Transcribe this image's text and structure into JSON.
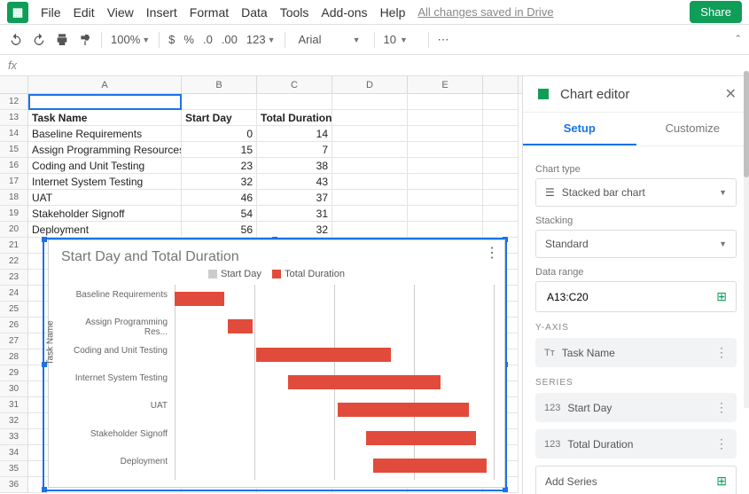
{
  "menu": {
    "items": [
      "File",
      "Edit",
      "View",
      "Insert",
      "Format",
      "Data",
      "Tools",
      "Add-ons",
      "Help"
    ],
    "save_status": "All changes saved in Drive",
    "share": "Share"
  },
  "toolbar": {
    "zoom": "100%",
    "currency": "$",
    "percent": "%",
    "dec_dec": ".0",
    "inc_dec": ".00",
    "numfmt": "123",
    "font": "Arial",
    "size": "10"
  },
  "sheet": {
    "columns": [
      "A",
      "B",
      "C",
      "D",
      "E"
    ],
    "col_widths": {
      "A": 173,
      "B": 85,
      "C": 85,
      "D": 85,
      "E": 85
    },
    "start_row": 12,
    "headers": {
      "A": "Task Name",
      "B": "Start Day",
      "C": "Total Duration"
    },
    "rows": [
      {
        "A": "Baseline Requirements",
        "B": 0,
        "C": 14
      },
      {
        "A": "Assign Programming Resources",
        "B": 15,
        "C": 7
      },
      {
        "A": "Coding and Unit Testing",
        "B": 23,
        "C": 38
      },
      {
        "A": "Internet System Testing",
        "B": 32,
        "C": 43
      },
      {
        "A": "UAT",
        "B": 46,
        "C": 37
      },
      {
        "A": "Stakeholder Signoff",
        "B": 54,
        "C": 31
      },
      {
        "A": "Deployment",
        "B": 56,
        "C": 32
      }
    ]
  },
  "chart_data": {
    "type": "bar",
    "orientation": "horizontal",
    "stacking": "Standard",
    "title": "Start Day and Total Duration",
    "ylabel": "Task Name",
    "xlim": [
      0,
      90
    ],
    "legend": [
      "Start Day",
      "Total Duration"
    ],
    "legend_colors": [
      "#cccccc",
      "#e14b3b"
    ],
    "categories": [
      "Baseline Requirements",
      "Assign Programming Res...",
      "Coding and Unit Testing",
      "Internet System Testing",
      "UAT",
      "Stakeholder Signoff",
      "Deployment"
    ],
    "series": [
      {
        "name": "Start Day",
        "values": [
          0,
          15,
          23,
          32,
          46,
          54,
          56
        ]
      },
      {
        "name": "Total Duration",
        "values": [
          14,
          7,
          38,
          43,
          37,
          31,
          32
        ]
      }
    ]
  },
  "editor": {
    "title": "Chart editor",
    "tabs": {
      "setup": "Setup",
      "customize": "Customize"
    },
    "chart_type_label": "Chart type",
    "chart_type_value": "Stacked bar chart",
    "stacking_label": "Stacking",
    "stacking_value": "Standard",
    "datarange_label": "Data range",
    "datarange_value": "A13:C20",
    "yaxis_label": "Y-AXIS",
    "yaxis_value": "Task Name",
    "series_label": "SERIES",
    "series": [
      "Start Day",
      "Total Duration"
    ],
    "add_series": "Add Series"
  }
}
